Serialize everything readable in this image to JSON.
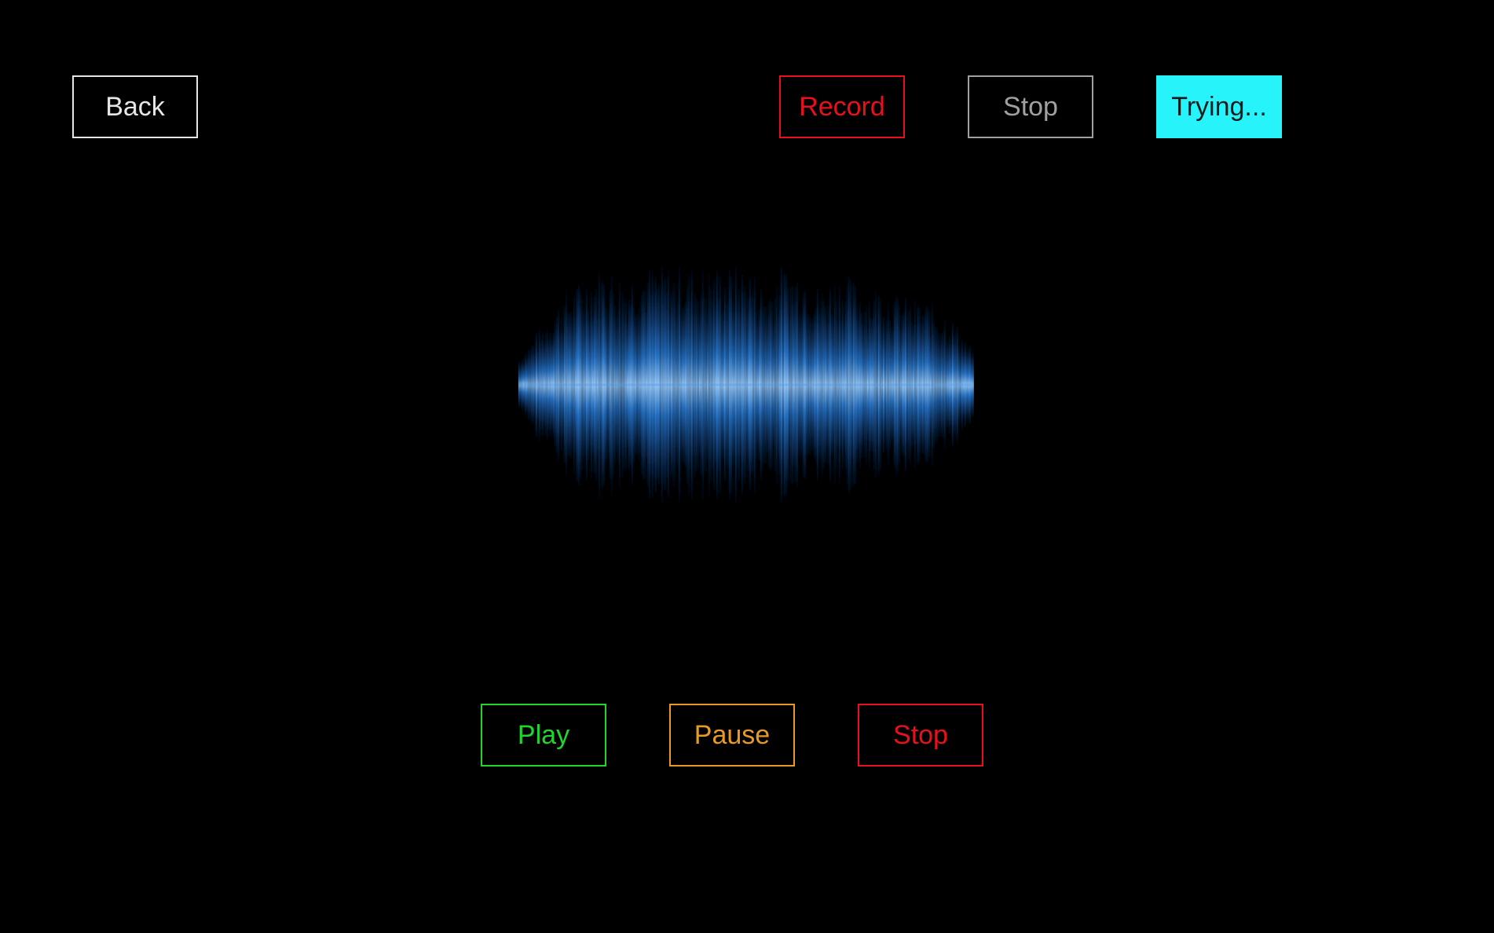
{
  "colors": {
    "background": "#000000",
    "back": "#e6e6e6",
    "record": "#e8101c",
    "stop_top": "#a0a0a0",
    "status_bg": "#26f4fa",
    "status_text": "#1a1a1a",
    "play": "#22d52c",
    "pause": "#e89a22",
    "stop_bottom": "#e8101c",
    "wave": "#3d8fe6"
  },
  "top_bar": {
    "back_label": "Back",
    "record_label": "Record",
    "stop_label": "Stop",
    "status_label": "Trying..."
  },
  "waveform": {
    "icon": "audio-waveform"
  },
  "playback": {
    "play_label": "Play",
    "pause_label": "Pause",
    "stop_label": "Stop"
  }
}
